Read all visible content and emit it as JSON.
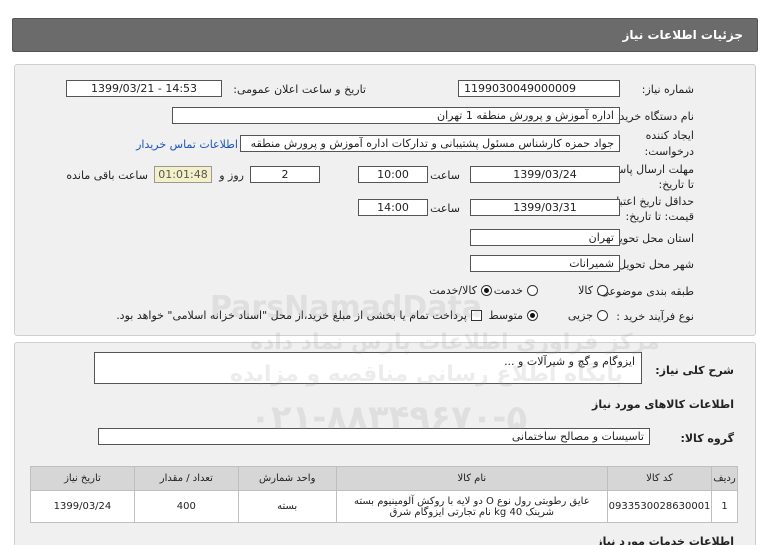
{
  "header": {
    "title": "جزئیات اطلاعات نیاز"
  },
  "fields": {
    "need_number_label": "شماره نیاز:",
    "need_number": "1199030049000009",
    "announce_label": "تاریخ و ساعت اعلان عمومی:",
    "announce_value": "1399/03/21 - 14:53",
    "buyer_label": "نام دستگاه خریدار:",
    "buyer_value": "اداره آموزش و پرورش منطقه 1 تهران",
    "creator_label_1": "ایجاد کننده",
    "creator_label_2": "درخواست:",
    "creator_value": "جواد حمزه کارشناس مسئول پشتیبانی و تدارکات اداره آموزش و پرورش منطقه",
    "contact_link": "اطلاعات تماس خریدار",
    "deadline_label_1": "مهلت ارسال پاسخ:",
    "deadline_label_2": "تا تاریخ:",
    "deadline_date": "1399/03/24",
    "time_label": "ساعت",
    "deadline_time": "10:00",
    "days_value": "2",
    "days_label": "روز و",
    "remaining_value": "01:01:48",
    "remaining_label": "ساعت باقی مانده",
    "validity_label_1": "حداقل تاریخ اعتبار",
    "validity_label_2": "قیمت: تا تاریخ:",
    "validity_date": "1399/03/31",
    "validity_time": "14:00",
    "province_label": "استان محل تحویل:",
    "province_value": "تهران",
    "city_label": "شهر محل تحویل:",
    "city_value": "شمیرانات",
    "category_label": "طبقه بندی موضوعی:",
    "category_options": [
      "کالا",
      "خدمت",
      "کالا/خدمت"
    ],
    "process_label": "نوع فرآیند خرید :",
    "process_options": [
      "جزیی",
      "متوسط"
    ],
    "payment_note": "پرداخت تمام یا بخشی از مبلغ خرید،از محل \"اسناد خزانه اسلامی\" خواهد بود."
  },
  "summary": {
    "label": "شرح کلی نیاز:",
    "value": "ایزوگام و گچ و شیرآلات و ..."
  },
  "goods": {
    "section_title": "اطلاعات کالاهای مورد نیاز",
    "group_label": "گروه کالا:",
    "group_value": "تاسیسات و مصالح ساختمانی",
    "columns": [
      "ردیف",
      "کد کالا",
      "نام کالا",
      "واحد شمارش",
      "تعداد / مقدار",
      "تاریخ نیاز"
    ],
    "rows": [
      {
        "row": "1",
        "code": "0933530028630001",
        "name_line1": "عایق رطوبتی رول نوع O دو لایه با روکش آلومینیوم بسته",
        "name_line2": "شرینک 40 kg نام تجارتی ایزوگام شرق",
        "unit": "بسته",
        "qty": "400",
        "date": "1399/03/24"
      }
    ]
  },
  "services": {
    "section_title": "اطلاعات خدمات مورد نیاز"
  },
  "watermark": {
    "brand": "ParsNamadData",
    "line1": "مرکز فراوری اطلاعات پارس نماد داده",
    "line2": "پایگاه اطلاع رسانی مناقصه و مزایده",
    "phone": "۰۲۱-۸۸۳۴۹۶۷۰-۵"
  }
}
